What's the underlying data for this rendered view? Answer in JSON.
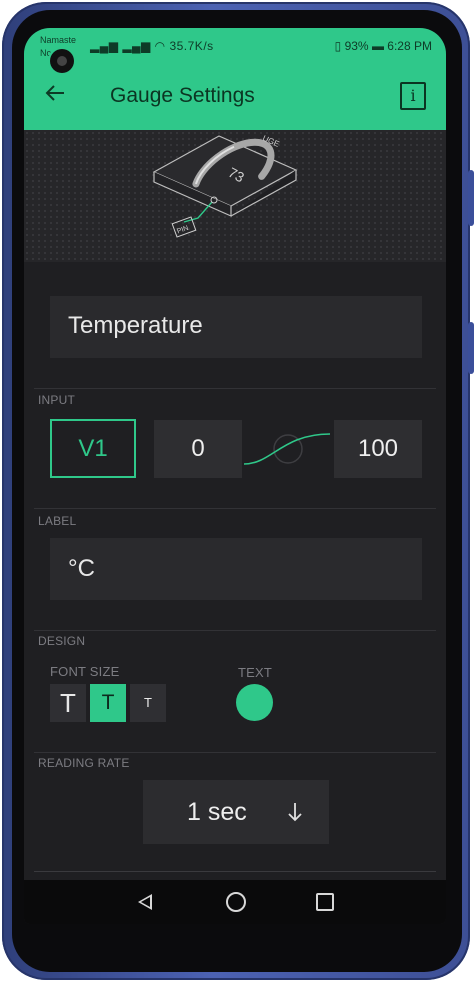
{
  "status_bar": {
    "carrier_line1": "Namaste",
    "carrier_line2": "Nc",
    "network_speed": "35.7K/s",
    "battery": "93%",
    "time": "6:28 PM"
  },
  "header": {
    "title": "Gauge Settings",
    "back_icon": "arrow-left-icon",
    "info_icon": "info-icon",
    "info_glyph": "i"
  },
  "hero": {
    "gauge_value": "73",
    "pin_label": "PIN",
    "tag_label": "UGE"
  },
  "form": {
    "name_value": "Temperature",
    "input": {
      "section_label": "INPUT",
      "pin": "V1",
      "min": "0",
      "max": "100"
    },
    "label": {
      "section_label": "LABEL",
      "value": "°C"
    },
    "design": {
      "section_label": "DESIGN",
      "font_size_label": "FONT SIZE",
      "font_sizes": [
        "T",
        "T",
        "T"
      ],
      "text_label": "TEXT",
      "text_color": "#2fc88a"
    },
    "reading_rate": {
      "section_label": "READING RATE",
      "value": "1 sec",
      "dropdown_icon": "arrow-down-icon"
    }
  },
  "colors": {
    "accent": "#2fc88a",
    "background": "#1f1f22",
    "field": "#2a2a2d"
  }
}
